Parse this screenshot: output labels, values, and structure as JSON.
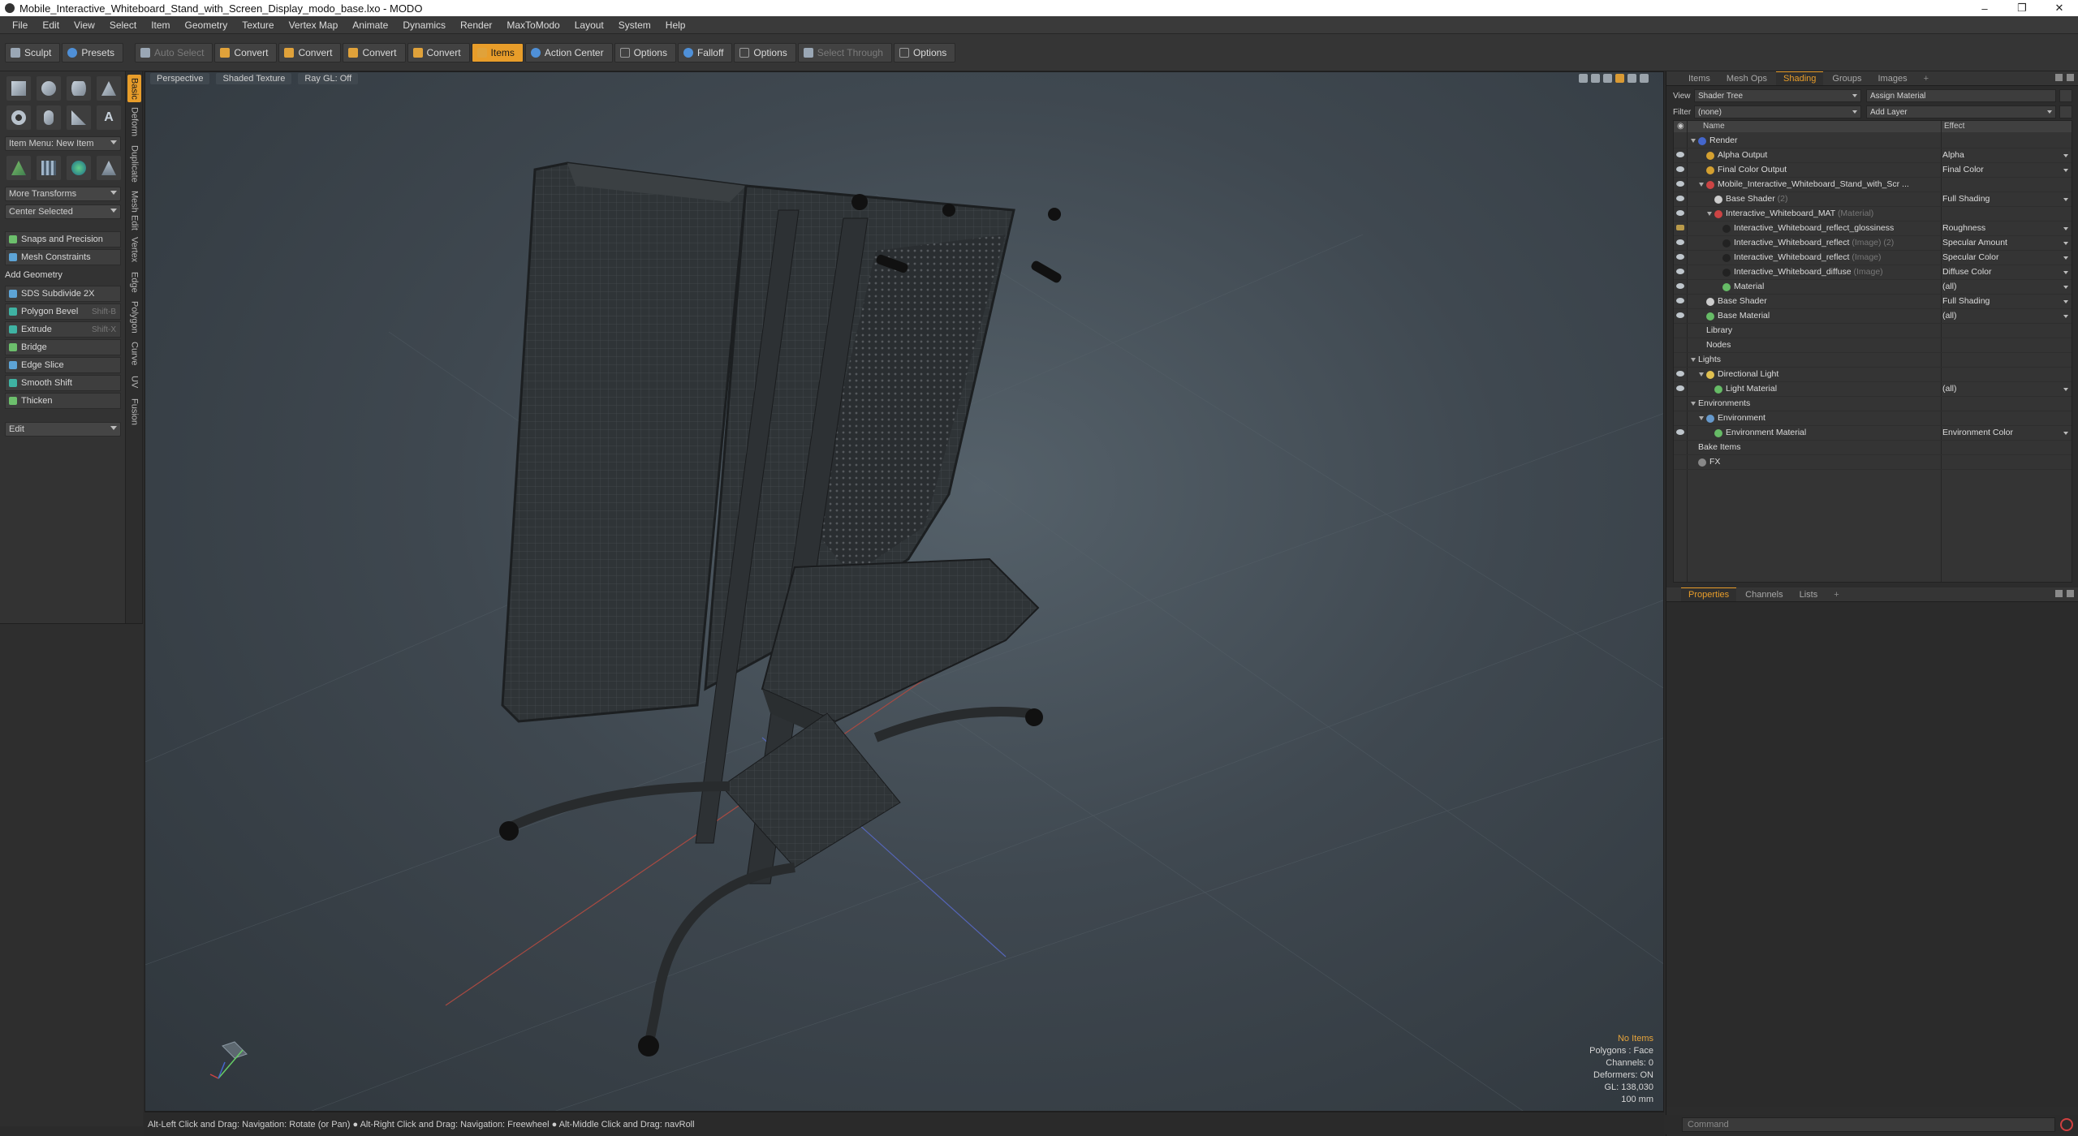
{
  "window": {
    "title": "Mobile_Interactive_Whiteboard_Stand_with_Screen_Display_modo_base.lxo - MODO",
    "buttons": [
      "–",
      "❐",
      "✕"
    ]
  },
  "menubar": [
    "File",
    "Edit",
    "View",
    "Select",
    "Item",
    "Geometry",
    "Texture",
    "Vertex Map",
    "Animate",
    "Dynamics",
    "Render",
    "MaxToModo",
    "Layout",
    "System",
    "Help"
  ],
  "toolbar": {
    "sculpt": "Sculpt",
    "presets": "Presets",
    "auto_select": "Auto Select",
    "convert1": "Convert",
    "convert2": "Convert",
    "convert3": "Convert",
    "convert4": "Convert",
    "items": "Items",
    "action_center": "Action Center",
    "options1": "Options",
    "falloff": "Falloff",
    "options2": "Options",
    "select_through": "Select Through",
    "options3": "Options"
  },
  "left_panel": {
    "item_menu": "Item Menu: New Item",
    "more_transforms": "More Transforms",
    "center_selected": "Center Selected",
    "snaps": "Snaps and Precision",
    "mesh_constraints": "Mesh Constraints",
    "add_geometry": "Add Geometry",
    "tools": [
      {
        "label": "SDS Subdivide 2X",
        "shortcut": ""
      },
      {
        "label": "Polygon Bevel",
        "shortcut": "Shift-B"
      },
      {
        "label": "Extrude",
        "shortcut": "Shift-X"
      },
      {
        "label": "Bridge",
        "shortcut": ""
      },
      {
        "label": "Edge Slice",
        "shortcut": ""
      },
      {
        "label": "Smooth Shift",
        "shortcut": ""
      },
      {
        "label": "Thicken",
        "shortcut": ""
      }
    ],
    "edit": "Edit",
    "vertical_tabs": [
      "Basic",
      "Deform",
      "Duplicate",
      "Mesh Edit",
      "Vertex",
      "Edge",
      "Polygon",
      "Curve",
      "UV",
      "Fusion"
    ]
  },
  "viewport": {
    "tabs": [
      "Perspective",
      "Shaded Texture",
      "Ray GL: Off"
    ],
    "info": {
      "no_items": "No Items",
      "polygons": "Polygons : Face",
      "channels": "Channels: 0",
      "deformers": "Deformers: ON",
      "gl": "GL: 138,030",
      "scale": "100 mm"
    }
  },
  "statusbar": "Alt-Left Click and Drag: Navigation: Rotate (or Pan) ● Alt-Right Click and Drag: Navigation: Freewheel ● Alt-Middle Click and Drag: navRoll",
  "right_panel": {
    "tabs": [
      "Items",
      "Mesh Ops",
      "Shading",
      "Groups",
      "Images",
      "+"
    ],
    "view_label": "View",
    "view_value": "Shader Tree",
    "assign_material": "Assign Material",
    "filter_label": "Filter",
    "filter_value": "(none)",
    "add_layer": "Add Layer",
    "col_name": "Name",
    "col_effect": "Effect",
    "tree": [
      {
        "label": "Render",
        "tag": "",
        "effect": "",
        "indent": 1,
        "eye": false,
        "expanded": true,
        "ico": "#4466cc"
      },
      {
        "label": "Alpha Output",
        "tag": "",
        "effect": "Alpha",
        "indent": 2,
        "eye": true,
        "ico": "#d4a030"
      },
      {
        "label": "Final Color Output",
        "tag": "",
        "effect": "Final Color",
        "indent": 2,
        "eye": true,
        "ico": "#d4a030"
      },
      {
        "label": "Mobile_Interactive_Whiteboard_Stand_with_Scr ...",
        "tag": "",
        "effect": "",
        "indent": 2,
        "eye": true,
        "expanded": true,
        "ico": "#cc4444"
      },
      {
        "label": "Base Shader",
        "tag": "(2)",
        "effect": "Full Shading",
        "indent": 3,
        "eye": true,
        "ico": "#cccccc"
      },
      {
        "label": "Interactive_Whiteboard_MAT",
        "tag": "(Material)",
        "effect": "",
        "indent": 3,
        "eye": true,
        "expanded": true,
        "ico": "#cc4444"
      },
      {
        "label": "Interactive_Whiteboard_reflect_glossiness",
        "tag": "",
        "effect": "Roughness",
        "indent": 4,
        "eye": "brush",
        "ico": "#222222"
      },
      {
        "label": "Interactive_Whiteboard_reflect",
        "tag": "(Image) (2)",
        "effect": "Specular Amount",
        "indent": 4,
        "eye": true,
        "ico": "#222222"
      },
      {
        "label": "Interactive_Whiteboard_reflect",
        "tag": "(Image)",
        "effect": "Specular Color",
        "indent": 4,
        "eye": true,
        "ico": "#222222"
      },
      {
        "label": "Interactive_Whiteboard_diffuse",
        "tag": "(Image)",
        "effect": "Diffuse Color",
        "indent": 4,
        "eye": true,
        "ico": "#222222"
      },
      {
        "label": "Material",
        "tag": "",
        "effect": "(all)",
        "indent": 4,
        "eye": true,
        "ico": "#66bb66"
      },
      {
        "label": "Base Shader",
        "tag": "",
        "effect": "Full Shading",
        "indent": 2,
        "eye": true,
        "ico": "#cccccc"
      },
      {
        "label": "Base Material",
        "tag": "",
        "effect": "(all)",
        "indent": 2,
        "eye": true,
        "ico": "#66bb66"
      },
      {
        "label": "Library",
        "tag": "",
        "effect": "",
        "indent": 2,
        "eye": false,
        "ico": ""
      },
      {
        "label": "Nodes",
        "tag": "",
        "effect": "",
        "indent": 2,
        "eye": false,
        "ico": ""
      },
      {
        "label": "Lights",
        "tag": "",
        "effect": "",
        "indent": 1,
        "eye": false,
        "expanded": true,
        "ico": ""
      },
      {
        "label": "Directional Light",
        "tag": "",
        "effect": "",
        "indent": 2,
        "eye": true,
        "expanded": true,
        "ico": "#e0c050"
      },
      {
        "label": "Light Material",
        "tag": "",
        "effect": "(all)",
        "indent": 3,
        "eye": true,
        "ico": "#66bb66"
      },
      {
        "label": "Environments",
        "tag": "",
        "effect": "",
        "indent": 1,
        "eye": false,
        "expanded": true,
        "ico": ""
      },
      {
        "label": "Environment",
        "tag": "",
        "effect": "",
        "indent": 2,
        "eye": false,
        "expanded": true,
        "ico": "#6699cc"
      },
      {
        "label": "Environment Material",
        "tag": "",
        "effect": "Environment Color",
        "indent": 3,
        "eye": true,
        "ico": "#66bb66"
      },
      {
        "label": "Bake Items",
        "tag": "",
        "effect": "",
        "indent": 1,
        "eye": false,
        "ico": ""
      },
      {
        "label": "FX",
        "tag": "",
        "effect": "",
        "indent": 1,
        "eye": false,
        "ico": "#888888"
      }
    ],
    "props_tabs": [
      "Properties",
      "Channels",
      "Lists",
      "+"
    ],
    "command_placeholder": "Command"
  },
  "colors": {
    "accent": "#e89d2a",
    "viewport_bg": "#3f4850"
  }
}
